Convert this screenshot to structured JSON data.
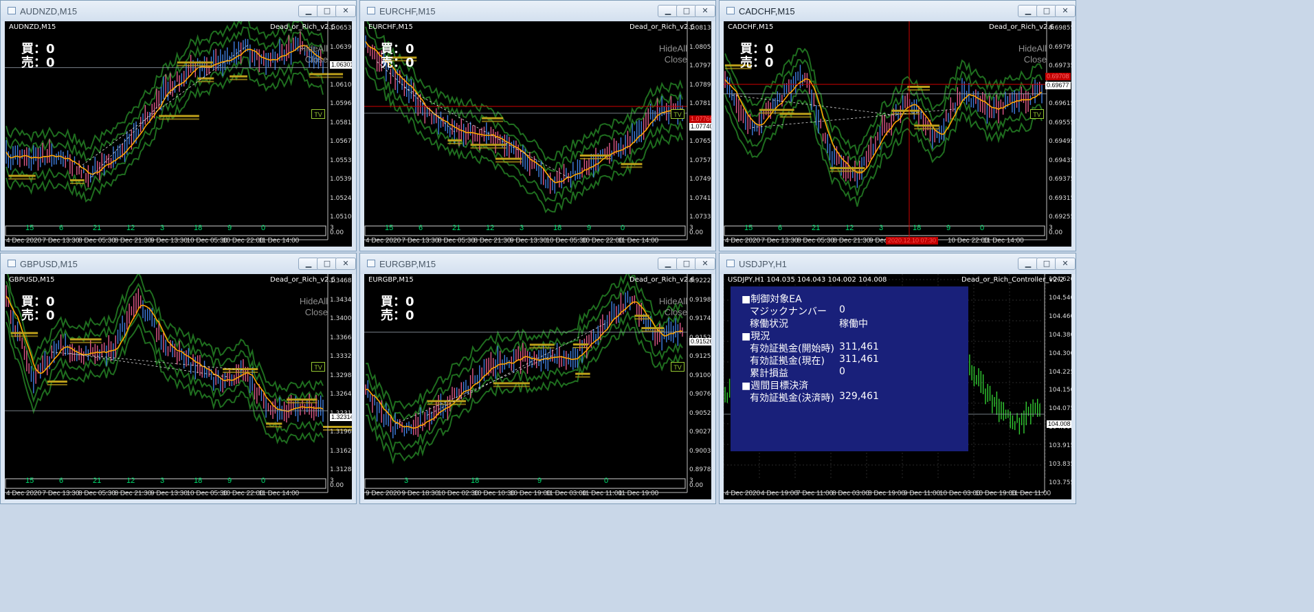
{
  "colors": {
    "bullish_bar": "#e05a8a",
    "bearish_bar": "#3f7fe0",
    "ma": "#ffa500",
    "band": "#1f6e1f",
    "level": "#bfa11b",
    "panel_bg": "#19207a",
    "usdjpy_bars": "#32cd32"
  },
  "controls": {
    "minimize": "minimize-icon",
    "maximize": "maximize-icon",
    "close": "close-icon"
  },
  "buy_label": "買：0",
  "sell_label": "売：0",
  "hideall_label": "HideAll",
  "close_label": "Close",
  "tv_label": "TV",
  "windows": [
    {
      "title": "AUDNZD,M15",
      "chart_label": "AUDNZD,M15",
      "ea_label": "Dead_or_Rich_v2.6",
      "ticks": [
        "1.06530",
        "1.06390",
        "1.06245",
        "1.06105",
        "1.05960",
        "1.05815",
        "1.05675",
        "1.05530",
        "1.05390",
        "1.05245",
        "1.05100"
      ],
      "price_tag": "1.06301",
      "x_labels": [
        "4 Dec 2020",
        "7 Dec 13:30",
        "8 Dec 05:30",
        "8 Dec 21:30",
        "9 Dec 13:30",
        "10 Dec 05:30",
        "10 Dec 22:00",
        "11 Dec 14:00"
      ],
      "sub_labels": [
        "15",
        "6",
        "21",
        "12",
        "3",
        "18",
        "9",
        "0"
      ],
      "sub_right": "3",
      "sub_zero": "0.00"
    },
    {
      "title": "EURCHF,M15",
      "chart_label": "EURCHF,M15",
      "ea_label": "Dead_or_Rich_v2.6",
      "ticks": [
        "1.08135",
        "1.08055",
        "1.07975",
        "1.07895",
        "1.07815",
        "1.07735",
        "1.07655",
        "1.07575",
        "1.07495",
        "1.07415",
        "1.07335"
      ],
      "price_tag": "1.07740",
      "price_tag2": "1.07766",
      "x_labels": [
        "4 Dec 2020",
        "7 Dec 13:30",
        "8 Dec 05:30",
        "8 Dec 21:30",
        "9 Dec 13:30",
        "10 Dec 05:30",
        "10 Dec 22:00",
        "11 Dec 14:00"
      ],
      "sub_labels": [
        "15",
        "6",
        "21",
        "12",
        "3",
        "18",
        "9",
        "0"
      ],
      "sub_right": "3",
      "sub_zero": "0.00"
    },
    {
      "title": "CADCHF,M15",
      "chart_label": "CADCHF,M15",
      "ea_label": "Dead_or_Rich_v2.6",
      "ticks": [
        "0.69855",
        "0.69795",
        "0.69735",
        "0.69677",
        "0.69615",
        "0.69555",
        "0.69495",
        "0.69435",
        "0.69375",
        "0.69315",
        "0.69255"
      ],
      "price_tag": "0.69677",
      "price_tag2": "0.69708",
      "x_labels": [
        "4 Dec 2020",
        "7 Dec 13:30",
        "8 Dec 05:30",
        "8 Dec 21:30",
        "9 Dec 1",
        "10 Dec 22:00",
        "11 Dec 14:00"
      ],
      "crosshair_time": "2020.12.10 07:30",
      "sub_labels": [
        "15",
        "6",
        "21",
        "12",
        "3",
        "18",
        "9",
        "0"
      ],
      "sub_right": "3",
      "sub_zero": "0.00"
    },
    {
      "title": "GBPUSD,M15",
      "chart_label": "GBPUSD,M15",
      "ea_label": "Dead_or_Rich_v2.6",
      "ticks": [
        "1.34680",
        "1.34340",
        "1.34000",
        "1.33660",
        "1.33320",
        "1.32980",
        "1.32640",
        "1.32314",
        "1.31960",
        "1.31620",
        "1.31280"
      ],
      "price_tag": "1.32314",
      "x_labels": [
        "4 Dec 2020",
        "7 Dec 13:30",
        "8 Dec 05:30",
        "8 Dec 21:30",
        "9 Dec 13:30",
        "10 Dec 05:30",
        "10 Dec 22:00",
        "11 Dec 14:00"
      ],
      "sub_labels": [
        "15",
        "6",
        "21",
        "12",
        "3",
        "18",
        "9",
        "0"
      ],
      "sub_right": "3",
      "sub_zero": "0.00"
    },
    {
      "title": "EURGBP,M15",
      "chart_label": "EURGBP,M15",
      "ea_label": "Dead_or_Rich_v2.6",
      "ticks": [
        "0.92225",
        "0.91980",
        "0.91740",
        "0.91526",
        "0.91250",
        "0.91005",
        "0.90765",
        "0.90520",
        "0.90275",
        "0.90030",
        "0.89785"
      ],
      "price_tag": "0.91526",
      "x_labels": [
        "9 Dec 2020",
        "9 Dec 18:30",
        "10 Dec 02:30",
        "10 Dec 10:30",
        "10 Dec 19:00",
        "11 Dec 03:00",
        "11 Dec 11:00",
        "11 Dec 19:00"
      ],
      "sub_labels": [
        "3",
        "18",
        "9",
        "0"
      ],
      "sub_right": "3",
      "sub_zero": "0.00"
    },
    {
      "title": "USDJPY,H1",
      "chart_label": "USDJPY,H1  104.035 104.043 104.002 104.008",
      "ea_label": "Dead_or_Rich_Controller_v2.2",
      "ticks": [
        "104.620",
        "104.540",
        "104.460",
        "104.380",
        "104.300",
        "104.225",
        "104.150",
        "104.075",
        "104.008",
        "103.915",
        "103.835",
        "103.755"
      ],
      "price_tag": "104.008",
      "x_labels": [
        "4 Dec 2020",
        "4 Dec 19:00",
        "7 Dec 11:00",
        "8 Dec 03:00",
        "8 Dec 19:00",
        "9 Dec 11:00",
        "10 Dec 03:00",
        "10 Dec 19:00",
        "11 Dec 11:00"
      ]
    }
  ],
  "panel": {
    "controlled_ea": "■制御対象EA",
    "magic_label": "マジックナンバー",
    "magic_value": "0",
    "status_label": "稼働状況",
    "status_value": "稼働中",
    "current": "■現況",
    "equity_start_label": "有効証拠金(開始時)",
    "equity_start_value": "311,461",
    "equity_now_label": "有効証拠金(現在)",
    "equity_now_value": "311,461",
    "cum_pl_label": "累計損益",
    "cum_pl_value": "0",
    "weekly": "■週間目標決済",
    "equity_settle_label": "有効証拠金(決済時)",
    "equity_settle_value": "329,461"
  }
}
